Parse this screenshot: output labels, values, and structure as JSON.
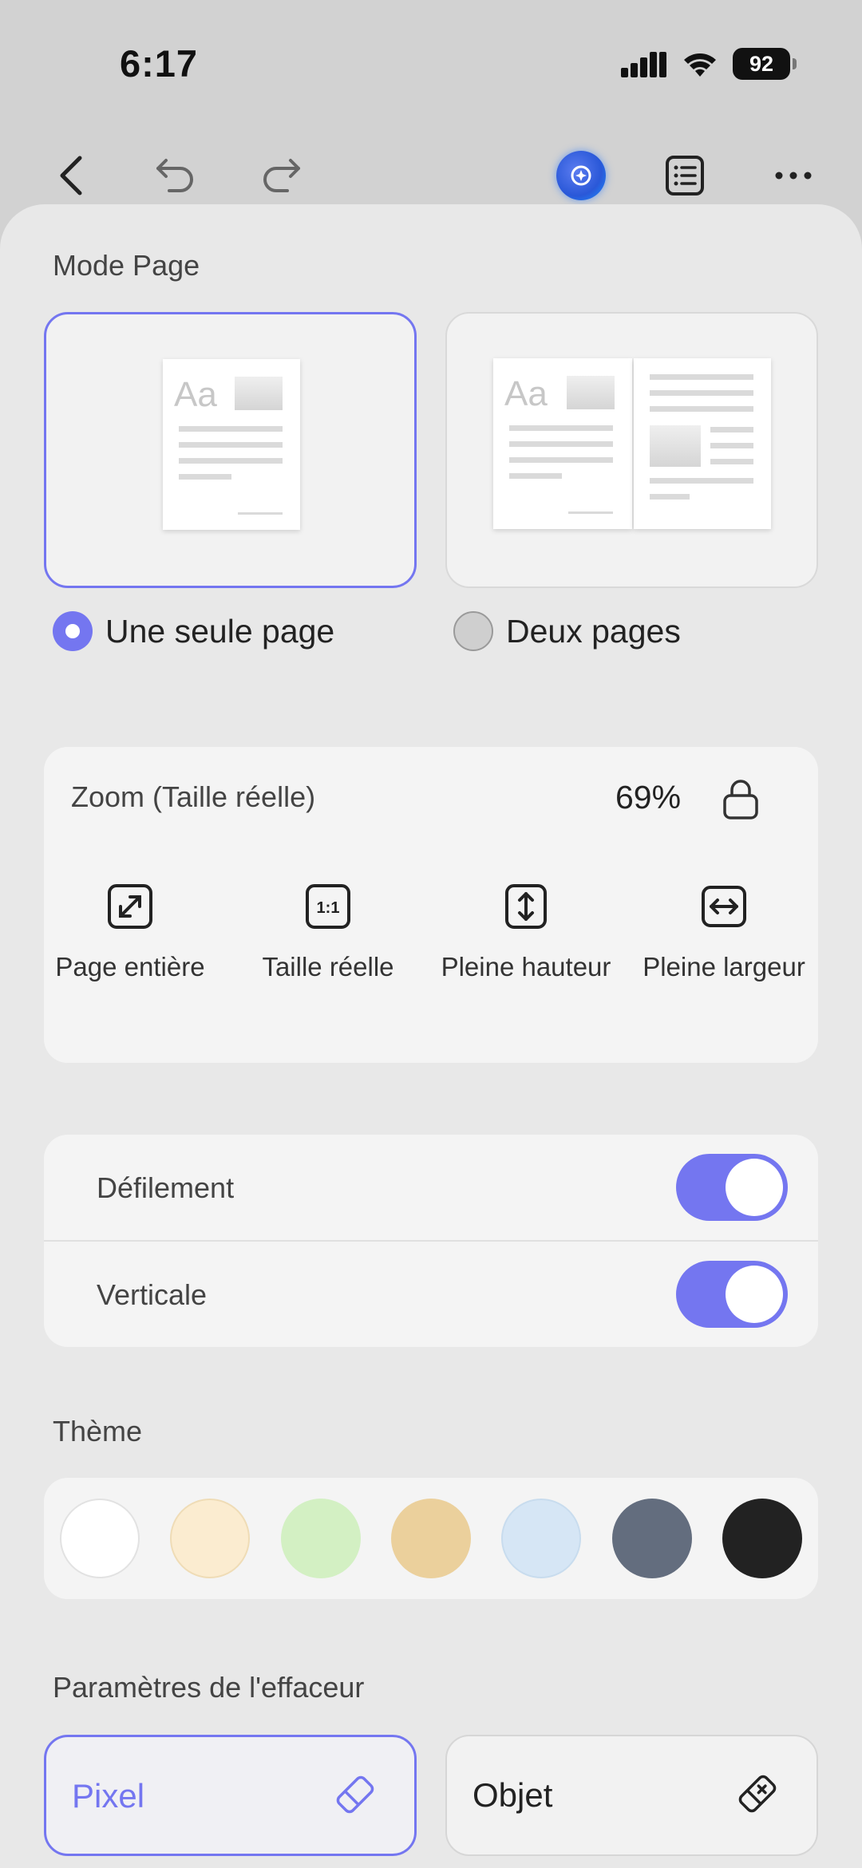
{
  "status": {
    "time": "6:17",
    "battery": "92"
  },
  "sheet": {
    "page_mode_label": "Mode Page",
    "single_page_label": "Une seule page",
    "two_pages_label": "Deux pages",
    "single_page_selected": true,
    "thumb_text": "Aa"
  },
  "zoom": {
    "title": "Zoom (Taille réelle)",
    "value": "69%",
    "options": [
      {
        "label": "Page entière",
        "icon": "fit-page-icon"
      },
      {
        "label": "Taille réelle",
        "icon": "actual-size-icon",
        "icon_text": "1:1"
      },
      {
        "label": "Pleine hauteur",
        "icon": "fit-height-icon"
      },
      {
        "label": "Pleine largeur",
        "icon": "fit-width-icon"
      }
    ]
  },
  "toggles": [
    {
      "label": "Défilement",
      "on": true
    },
    {
      "label": "Verticale",
      "on": true
    }
  ],
  "theme": {
    "label": "Thème",
    "colors": [
      "#ffffff",
      "#fbecd0",
      "#d3f0c3",
      "#ebd09c",
      "#d6e6f5",
      "#636d7e",
      "#222222"
    ]
  },
  "eraser": {
    "label": "Paramètres de l'effaceur",
    "pixel_label": "Pixel",
    "object_label": "Objet",
    "selected": "pixel"
  },
  "accent_color": "#7476f0"
}
